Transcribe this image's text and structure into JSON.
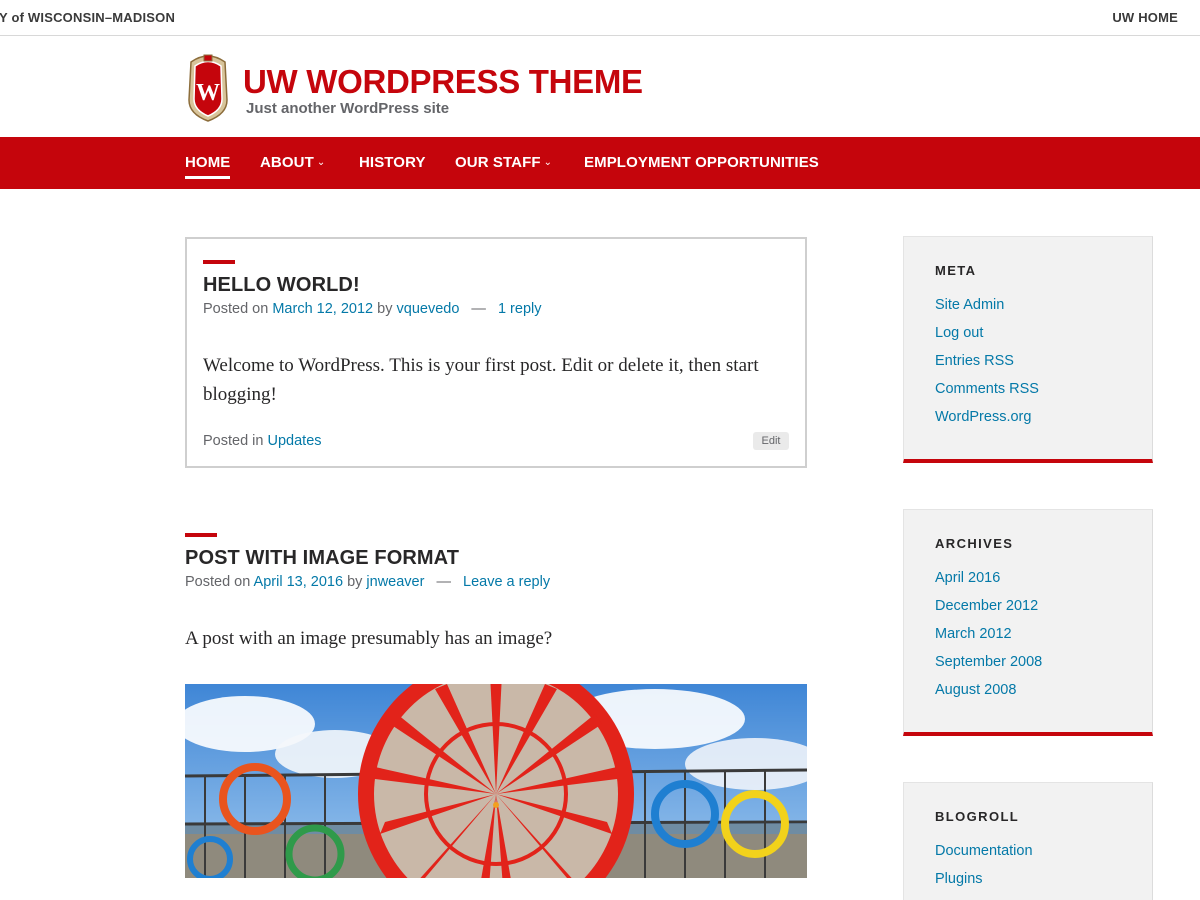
{
  "topbar": {
    "university": "Y of WISCONSIN–MADISON",
    "uw_home": "UW HOME"
  },
  "header": {
    "title": "UW WORDPRESS THEME",
    "description": "Just another WordPress site",
    "crest_letter": "W"
  },
  "nav": {
    "items": [
      {
        "label": "HOME",
        "active": true
      },
      {
        "label": "ABOUT",
        "dropdown": true
      },
      {
        "label": "HISTORY"
      },
      {
        "label": "OUR STAFF",
        "dropdown": true
      },
      {
        "label": "EMPLOYMENT OPPORTUNITIES"
      }
    ],
    "caret": "⌵"
  },
  "posts": [
    {
      "title": "HELLO WORLD!",
      "posted_on": "Posted on",
      "date": "March 12, 2012",
      "by": "by",
      "author": "vquevedo",
      "dash": "—",
      "comments": "1 reply",
      "body": "Welcome to WordPress. This is your first post. Edit or delete it, then start blogging!",
      "posted_in": "Posted in",
      "category": "Updates",
      "edit": "Edit"
    },
    {
      "title": "POST WITH IMAGE FORMAT",
      "posted_on": "Posted on",
      "date": "April 13, 2016",
      "by": "by",
      "author": "jnweaver",
      "dash": "—",
      "comments": "Leave a reply",
      "body": "A post with an image presumably has an image?"
    }
  ],
  "sidebar": {
    "meta": {
      "title": "META",
      "links": [
        "Site Admin",
        "Log out",
        "Entries RSS",
        "Comments RSS",
        "WordPress.org"
      ]
    },
    "archives": {
      "title": "ARCHIVES",
      "links": [
        "April 2016",
        "December 2012",
        "March 2012",
        "September 2008",
        "August 2008"
      ]
    },
    "blogroll": {
      "title": "BLOGROLL",
      "links": [
        "Documentation",
        "Plugins"
      ]
    }
  },
  "colors": {
    "brand_red": "#c5050c",
    "link_blue": "#0479a8",
    "text_dark": "#282728",
    "text_gray": "#646569"
  }
}
